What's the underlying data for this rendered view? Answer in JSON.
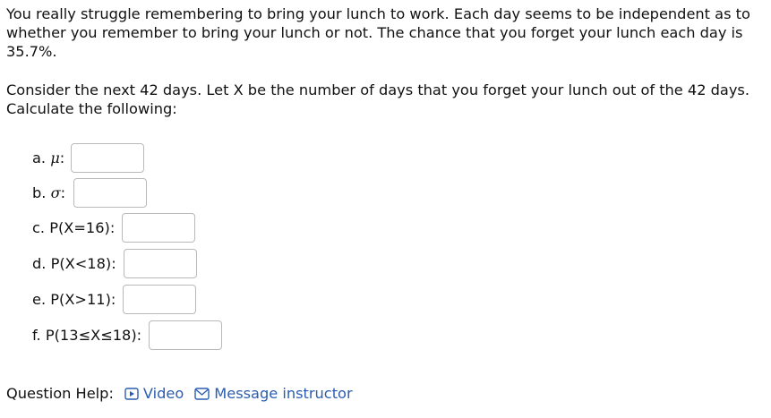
{
  "question": {
    "paragraph1": "You really struggle remembering to bring your lunch to work. Each day seems to be independent as to whether you remember to bring your lunch or not. The chance that you forget your lunch each day is 35.7%.",
    "paragraph2": "Consider the next 42 days. Let X be the number of days that you forget your lunch out of the 42 days. Calculate the following:"
  },
  "parts": [
    {
      "prefix": "a.",
      "symbol": "μ",
      "suffix": ":",
      "value": ""
    },
    {
      "prefix": "b.",
      "symbol": "σ",
      "suffix": ":",
      "value": ""
    },
    {
      "prefix": "c.",
      "text": "P(X=16):",
      "value": ""
    },
    {
      "prefix": "d.",
      "text": "P(X<18):",
      "value": ""
    },
    {
      "prefix": "e.",
      "text": "P(X>11):",
      "value": ""
    },
    {
      "prefix": "f.",
      "text": "P(13≤X≤18):",
      "value": ""
    }
  ],
  "help": {
    "label": "Question Help:",
    "video_label": "Video",
    "message_label": "Message instructor",
    "video_icon": "play-icon",
    "message_icon": "envelope-icon",
    "link_color": "#2a5db0"
  }
}
